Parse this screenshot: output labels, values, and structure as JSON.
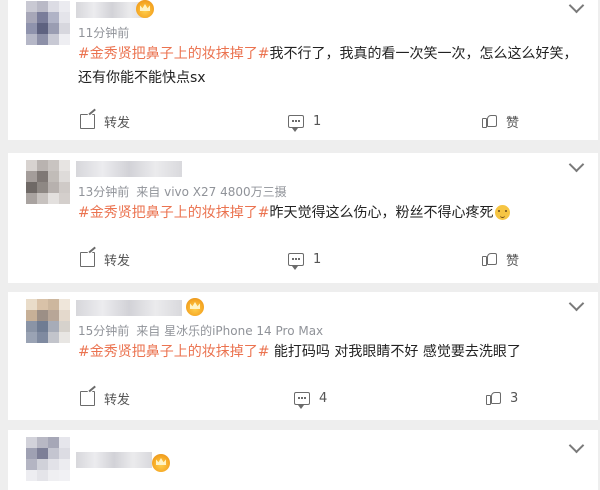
{
  "comments": [
    {
      "time": "11分钟前",
      "source": "",
      "topic": "#金秀贤把鼻子上的妆抹掉了#",
      "body": "我不行了，我真的看一次笑一次，怎么这么好笑，还有你能不能快点sx",
      "has_emoji": false,
      "share_label": "转发",
      "comment_count": "1",
      "like_label": "赞",
      "avatar_colors": [
        "#c9c9d3",
        "#b9b9c6",
        "#dcdce4",
        "#ebebf0",
        "#a7a7b8",
        "#7a7d9a",
        "#b0b3c6",
        "#e4e4ea",
        "#8f93ad",
        "#5e6280",
        "#9a9db2",
        "#d7d7de",
        "#b5b7c7",
        "#8d90a8",
        "#c8c9d4",
        "#eeeeF2"
      ]
    },
    {
      "time": "13分钟前",
      "source": "来自 vivo X27 4800万三摄",
      "topic": "#金秀贤把鼻子上的妆抹掉了#",
      "body": "昨天觉得这么伤心，粉丝不得心疼死",
      "has_emoji": true,
      "share_label": "转发",
      "comment_count": "1",
      "like_label": "赞",
      "avatar_colors": [
        "#d8d3d0",
        "#b9b3b0",
        "#c9c4c1",
        "#e7e4e2",
        "#a49d9a",
        "#7f7875",
        "#c1bcb8",
        "#dedbd9",
        "#6f6966",
        "#8e8884",
        "#b7b1ae",
        "#cfcac7",
        "#a9a3a0",
        "#c7c2bf",
        "#e3e0de",
        "#d4cfcc"
      ]
    },
    {
      "time": "15分钟前",
      "source": "来自 星冰乐的iPhone 14 Pro Max",
      "topic": "#金秀贤把鼻子上的妆抹掉了#",
      "body": " 能打码吗 对我眼睛不好 感觉要去洗眼了",
      "has_emoji": false,
      "share_label": "转发",
      "comment_count": "4",
      "like_count": "3",
      "avatar_colors": [
        "#e9dcc9",
        "#d9c2a8",
        "#cdb79e",
        "#efe6da",
        "#c7b097",
        "#9c8f86",
        "#b8a697",
        "#e4d9cc",
        "#8a94a6",
        "#6f7c93",
        "#a7acb8",
        "#d6d2cc",
        "#9aa3b4",
        "#7f8aa0",
        "#c2c4cb",
        "#e8e6e3"
      ]
    },
    {
      "avatar_colors": [
        "#d2d2da",
        "#b8b8c4",
        "#a6a7b7",
        "#e6e6ec",
        "#9fa1b3",
        "#7d7f97",
        "#c4c5d0",
        "#dcdce3",
        "#b4b5c3",
        "#d0d1d9",
        "#e2e2e8",
        "#ececf0",
        "#ededf1",
        "#e4e4e9",
        "#efeff2",
        "#f1f1f4"
      ]
    }
  ]
}
